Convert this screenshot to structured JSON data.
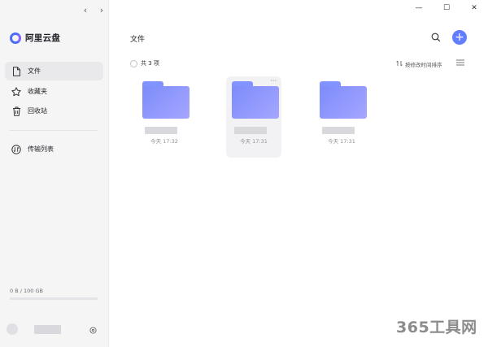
{
  "app": {
    "name": "阿里云盘"
  },
  "nav": {
    "back": "‹",
    "forward": "›"
  },
  "sidebar": {
    "items": [
      {
        "label": "文件",
        "icon": "file-icon",
        "active": true
      },
      {
        "label": "收藏夹",
        "icon": "star-icon",
        "active": false
      },
      {
        "label": "回收站",
        "icon": "trash-icon",
        "active": false
      },
      {
        "label": "传输列表",
        "icon": "transfer-icon",
        "active": false
      }
    ],
    "storage": {
      "text": "0 B / 100 GB",
      "used_fraction": 0
    }
  },
  "window": {
    "minimize": "—",
    "maximize": "☐",
    "close": "✕"
  },
  "main": {
    "title": "文件",
    "count_label": "共 3 项",
    "sort_label": "按修改时间排序",
    "files": [
      {
        "time": "今天 17:32",
        "hover": false
      },
      {
        "time": "今天 17:31",
        "hover": true
      },
      {
        "time": "今天 17:31",
        "hover": false
      }
    ]
  },
  "watermark": "365工具网",
  "colors": {
    "accent": "#637dff",
    "folder": "#8193ff"
  }
}
